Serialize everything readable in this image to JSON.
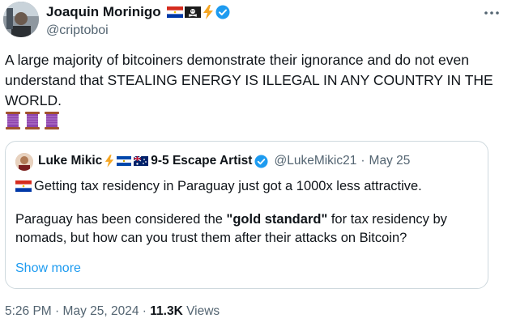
{
  "author": {
    "name": "Joaquin Morinigo",
    "handle": "@criptoboi",
    "badges": [
      "paraguay-flag",
      "pirate-flag",
      "lightning",
      "verified-badge"
    ]
  },
  "tweet": {
    "text": "A large majority of bitcoiners demonstrate their ignorance and do not even understand that STEALING ENERGY IS ILLEGAL IN ANY COUNTRY IN THE WORLD.",
    "emoji": [
      "spool-icon",
      "spool-icon",
      "spool-icon"
    ]
  },
  "quote": {
    "name": "Luke Mikic",
    "name_suffix": "9-5 Escape Artist",
    "name_badges": [
      "lightning",
      "el-salvador-flag",
      "australia-flag"
    ],
    "handle": "@LukeMikic21",
    "separator": "·",
    "date": "May 25",
    "line1": "Getting tax residency in Paraguay just got a 1000x less attractive.",
    "line2_pre": "Paraguay has been considered the ",
    "line2_bold": "\"gold standard\"",
    "line2_post": " for tax residency by nomads, but how can you trust them after their attacks on Bitcoin?",
    "show_more": "Show more"
  },
  "footer": {
    "time": "5:26 PM",
    "separator1": "·",
    "date": "May 25, 2024",
    "separator2": "·",
    "views_count": "11.3K",
    "views_label": "Views"
  },
  "colors": {
    "text": "#0f1419",
    "secondary": "#536471",
    "link": "#1d9bf0",
    "border": "#cfd9de",
    "verified": "#1d9bf0"
  }
}
